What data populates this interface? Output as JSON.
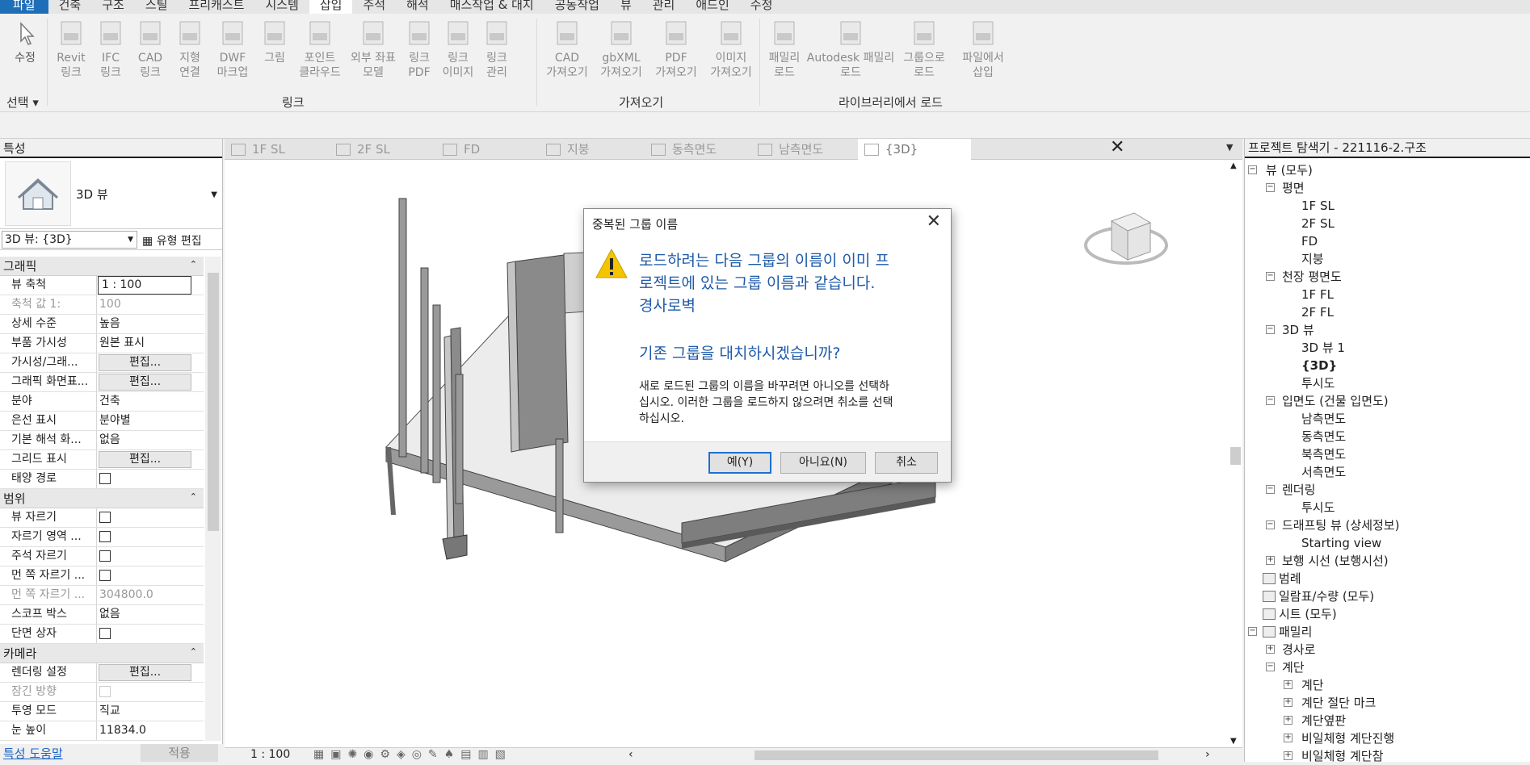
{
  "menubar": {
    "tabs": [
      "파일",
      "건축",
      "구조",
      "스틸",
      "프리캐스트",
      "시스템",
      "삽입",
      "주석",
      "해석",
      "매스작업 & 대지",
      "공동작업",
      "뷰",
      "관리",
      "애드인",
      "수정"
    ],
    "active": "삽입"
  },
  "ribbon": {
    "select_label": "수정",
    "select_group": "선택",
    "link_buttons": [
      {
        "name": "revit-link",
        "label": "Revit\n링크"
      },
      {
        "name": "ifc-link",
        "label": "IFC\n링크"
      },
      {
        "name": "cad-link",
        "label": "CAD\n링크"
      },
      {
        "name": "topography-link",
        "label": "지형\n연결"
      },
      {
        "name": "dwf-markup",
        "label": "DWF\n마크업"
      },
      {
        "name": "decal",
        "label": "그림"
      },
      {
        "name": "point-cloud",
        "label": "포인트\n클라우드"
      },
      {
        "name": "coordination-model",
        "label": "외부 좌표\n모델"
      },
      {
        "name": "link-pdf",
        "label": "링크\nPDF"
      },
      {
        "name": "link-image",
        "label": "링크\n이미지"
      },
      {
        "name": "manage-links",
        "label": "링크\n관리"
      }
    ],
    "link_group": "링크",
    "import_buttons": [
      {
        "name": "import-cad",
        "label": "CAD\n가져오기"
      },
      {
        "name": "import-gbxml",
        "label": "gbXML\n가져오기"
      },
      {
        "name": "import-pdf",
        "label": "PDF\n가져오기"
      },
      {
        "name": "import-image",
        "label": "이미지\n가져오기"
      }
    ],
    "import_group": "가져오기",
    "library_buttons": [
      {
        "name": "load-family",
        "label": "패밀리\n로드"
      },
      {
        "name": "autodesk-family",
        "label": "Autodesk 패밀리\n로드"
      },
      {
        "name": "load-as-group",
        "label": "그룹으로\n로드"
      },
      {
        "name": "insert-from-file",
        "label": "파일에서\n삽입"
      }
    ],
    "library_group": "라이브러리에서 로드"
  },
  "properties": {
    "header": "특성",
    "type_name": "3D 뷰",
    "selector": "3D 뷰: {3D}",
    "type_edit": "유형 편집",
    "sections": [
      {
        "title": "그래픽",
        "rows": [
          {
            "name": "뷰 축척",
            "value": "1 : 100",
            "kind": "input"
          },
          {
            "name": "축척 값    1:",
            "value": "100",
            "kind": "dim"
          },
          {
            "name": "상세 수준",
            "value": "높음",
            "kind": "text"
          },
          {
            "name": "부품 가시성",
            "value": "원본 표시",
            "kind": "text"
          },
          {
            "name": "가시성/그래...",
            "value": "편집...",
            "kind": "button"
          },
          {
            "name": "그래픽 화면표...",
            "value": "편집...",
            "kind": "button"
          },
          {
            "name": "분야",
            "value": "건축",
            "kind": "text"
          },
          {
            "name": "은선 표시",
            "value": "분야별",
            "kind": "text"
          },
          {
            "name": "기본 해석 화...",
            "value": "없음",
            "kind": "text"
          },
          {
            "name": "그리드 표시",
            "value": "편집...",
            "kind": "button"
          },
          {
            "name": "태양 경로",
            "value": "",
            "kind": "check"
          }
        ]
      },
      {
        "title": "범위",
        "rows": [
          {
            "name": "뷰 자르기",
            "value": "",
            "kind": "check"
          },
          {
            "name": "자르기 영역 ...",
            "value": "",
            "kind": "check"
          },
          {
            "name": "주석 자르기",
            "value": "",
            "kind": "check"
          },
          {
            "name": "먼 쪽 자르기 ...",
            "value": "",
            "kind": "check"
          },
          {
            "name": "먼 쪽 자르기 ...",
            "value": "304800.0",
            "kind": "dim"
          },
          {
            "name": "스코프 박스",
            "value": "없음",
            "kind": "text"
          },
          {
            "name": "단면 상자",
            "value": "",
            "kind": "check"
          }
        ]
      },
      {
        "title": "카메라",
        "rows": [
          {
            "name": "렌더링 설정",
            "value": "편집...",
            "kind": "button"
          },
          {
            "name": "잠긴 방향",
            "value": "",
            "kind": "dimcheck"
          },
          {
            "name": "투영 모드",
            "value": "직교",
            "kind": "text"
          },
          {
            "name": "눈 높이",
            "value": "11834.0",
            "kind": "text"
          }
        ]
      }
    ],
    "help_link": "특성 도움말",
    "apply": "적용"
  },
  "view_tabs": [
    {
      "label": "1F SL",
      "icon": "floor-plan-icon"
    },
    {
      "label": "2F SL",
      "icon": "floor-plan-icon"
    },
    {
      "label": "FD",
      "icon": "floor-plan-icon"
    },
    {
      "label": "지붕",
      "icon": "floor-plan-icon"
    },
    {
      "label": "동측면도",
      "icon": "elevation-icon"
    },
    {
      "label": "남측면도",
      "icon": "elevation-icon"
    },
    {
      "label": "{3D}",
      "icon": "3d-view-icon"
    }
  ],
  "view_scale": "1 : 100",
  "browser": {
    "header": "프로젝트 탐색기 - 221116-2.구조",
    "nodes": [
      {
        "label": "뷰 (모두)",
        "lvl": 0,
        "exp": "-"
      },
      {
        "label": "평면",
        "lvl": 1,
        "exp": "-"
      },
      {
        "label": "1F SL",
        "lvl": 2,
        "exp": ""
      },
      {
        "label": "2F SL",
        "lvl": 2,
        "exp": ""
      },
      {
        "label": "FD",
        "lvl": 2,
        "exp": ""
      },
      {
        "label": "지붕",
        "lvl": 2,
        "exp": ""
      },
      {
        "label": "천장 평면도",
        "lvl": 1,
        "exp": "-"
      },
      {
        "label": "1F FL",
        "lvl": 2,
        "exp": ""
      },
      {
        "label": "2F FL",
        "lvl": 2,
        "exp": ""
      },
      {
        "label": "3D 뷰",
        "lvl": 1,
        "exp": "-"
      },
      {
        "label": "3D 뷰 1",
        "lvl": 2,
        "exp": ""
      },
      {
        "label": "{3D}",
        "lvl": 2,
        "exp": "",
        "bold": true
      },
      {
        "label": "투시도",
        "lvl": 2,
        "exp": ""
      },
      {
        "label": "입면도 (건물 입면도)",
        "lvl": 1,
        "exp": "-"
      },
      {
        "label": "남측면도",
        "lvl": 2,
        "exp": ""
      },
      {
        "label": "동측면도",
        "lvl": 2,
        "exp": ""
      },
      {
        "label": "북측면도",
        "lvl": 2,
        "exp": ""
      },
      {
        "label": "서측면도",
        "lvl": 2,
        "exp": ""
      },
      {
        "label": "렌더링",
        "lvl": 1,
        "exp": "-"
      },
      {
        "label": "투시도",
        "lvl": 2,
        "exp": ""
      },
      {
        "label": "드래프팅 뷰 (상세정보)",
        "lvl": 1,
        "exp": "-"
      },
      {
        "label": "Starting view",
        "lvl": 2,
        "exp": ""
      },
      {
        "label": "보행 시선 (보행시선)",
        "lvl": 1,
        "exp": "+"
      },
      {
        "label": "범례",
        "lvl": 0,
        "exp": "",
        "icon": true
      },
      {
        "label": "일람표/수량 (모두)",
        "lvl": 0,
        "exp": "",
        "icon": true
      },
      {
        "label": "시트 (모두)",
        "lvl": 0,
        "exp": "",
        "icon": true
      },
      {
        "label": "패밀리",
        "lvl": 0,
        "exp": "-",
        "icon": true
      },
      {
        "label": "경사로",
        "lvl": 1,
        "exp": "+"
      },
      {
        "label": "계단",
        "lvl": 1,
        "exp": "-"
      },
      {
        "label": "계단",
        "lvl": 2,
        "exp": "+"
      },
      {
        "label": "계단 절단 마크",
        "lvl": 2,
        "exp": "+"
      },
      {
        "label": "계단옆판",
        "lvl": 2,
        "exp": "+"
      },
      {
        "label": "비일체형 계단진행",
        "lvl": 2,
        "exp": "+"
      },
      {
        "label": "비일체형 계단참",
        "lvl": 2,
        "exp": "+"
      }
    ]
  },
  "dialog": {
    "title": "중복된 그룹 이름",
    "main_lines": [
      "로드하려는 다음 그룹의 이름이 이미 프",
      "로젝트에 있는 그룹 이름과 같습니다.",
      "경사로벽"
    ],
    "question": "기존 그룹을 대치하시겠습니까?",
    "sub_lines": [
      "새로 로드된 그룹의 이름을 바꾸려면 아니오를 선택하",
      "십시오. 이러한 그룹을 로드하지 않으려면 취소를 선택",
      "하십시오."
    ],
    "yes": "예(Y)",
    "no": "아니요(N)",
    "cancel": "취소"
  },
  "colors": {
    "accent": "#1f6fb8",
    "dialog_text": "#1e5aa8",
    "warning": "#f5c400"
  }
}
